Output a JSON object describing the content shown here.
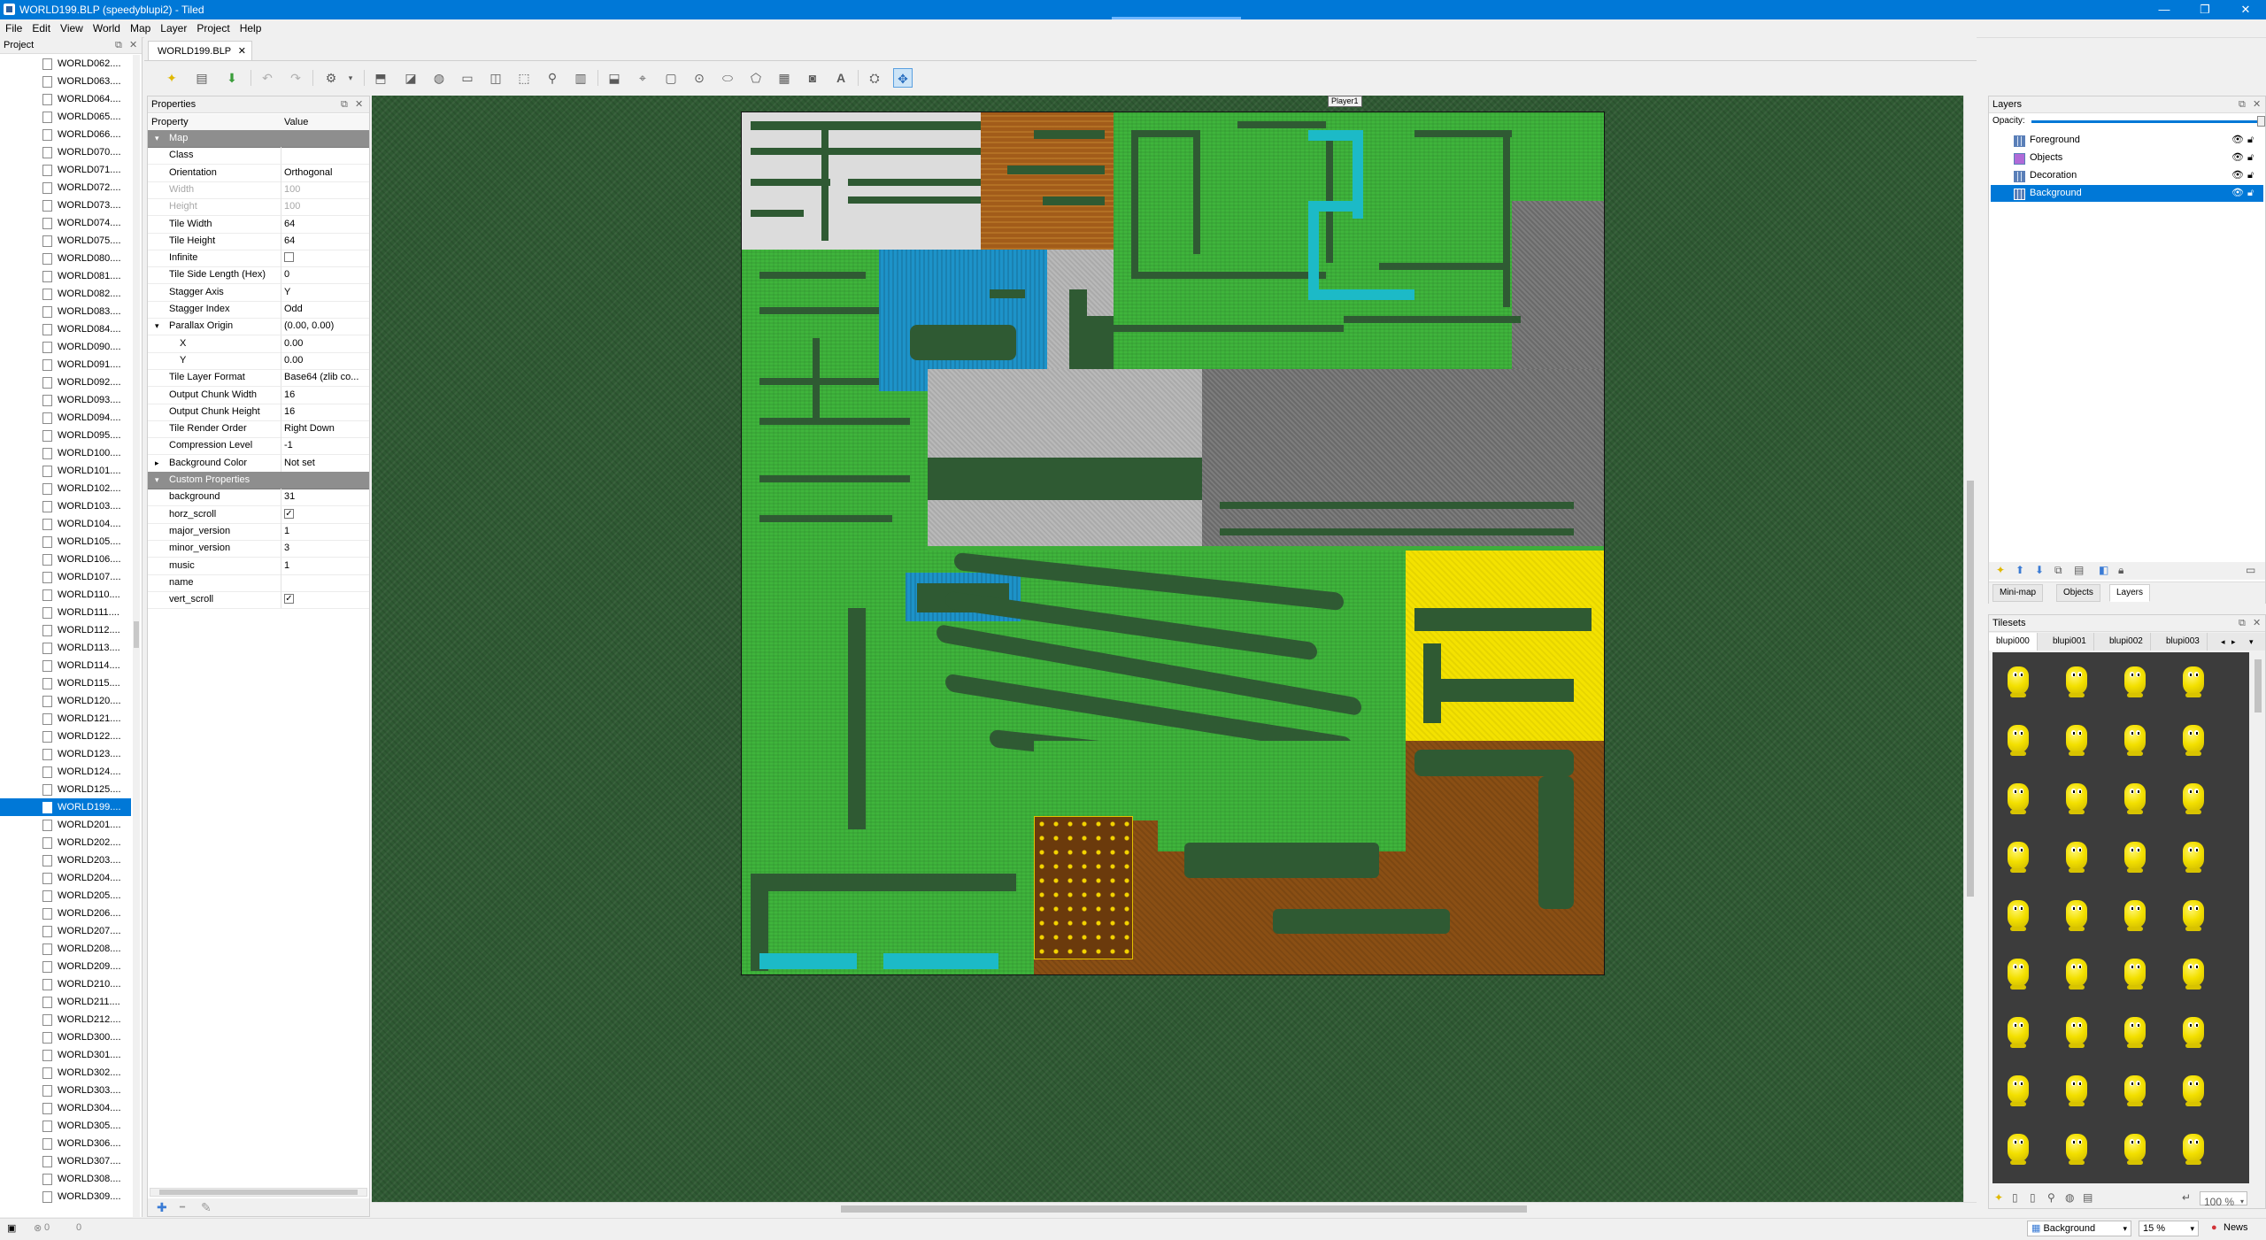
{
  "window": {
    "title": "WORLD199.BLP (speedyblupi2) - Tiled",
    "minimize": "—",
    "maximize": "❐",
    "close": "✕"
  },
  "menu": [
    "File",
    "Edit",
    "View",
    "World",
    "Map",
    "Layer",
    "Project",
    "Help"
  ],
  "project": {
    "title": "Project",
    "selected": "WORLD199....",
    "items": [
      "WORLD062....",
      "WORLD063....",
      "WORLD064....",
      "WORLD065....",
      "WORLD066....",
      "WORLD070....",
      "WORLD071....",
      "WORLD072....",
      "WORLD073....",
      "WORLD074....",
      "WORLD075....",
      "WORLD080....",
      "WORLD081....",
      "WORLD082....",
      "WORLD083....",
      "WORLD084....",
      "WORLD090....",
      "WORLD091....",
      "WORLD092....",
      "WORLD093....",
      "WORLD094....",
      "WORLD095....",
      "WORLD100....",
      "WORLD101....",
      "WORLD102....",
      "WORLD103....",
      "WORLD104....",
      "WORLD105....",
      "WORLD106....",
      "WORLD107....",
      "WORLD110....",
      "WORLD111....",
      "WORLD112....",
      "WORLD113....",
      "WORLD114....",
      "WORLD115....",
      "WORLD120....",
      "WORLD121....",
      "WORLD122....",
      "WORLD123....",
      "WORLD124....",
      "WORLD125....",
      "WORLD199....",
      "WORLD201....",
      "WORLD202....",
      "WORLD203....",
      "WORLD204....",
      "WORLD205....",
      "WORLD206....",
      "WORLD207....",
      "WORLD208....",
      "WORLD209....",
      "WORLD210....",
      "WORLD211....",
      "WORLD212....",
      "WORLD300....",
      "WORLD301....",
      "WORLD302....",
      "WORLD303....",
      "WORLD304....",
      "WORLD305....",
      "WORLD306....",
      "WORLD307....",
      "WORLD308....",
      "WORLD309...."
    ]
  },
  "doc_tab": {
    "label": "WORLD199.BLP",
    "close": "✕"
  },
  "properties": {
    "title": "Properties",
    "col_property": "Property",
    "col_value": "Value",
    "rows": [
      {
        "key": "Map",
        "value": "",
        "type": "group",
        "arrow": "▾"
      },
      {
        "key": "Class",
        "value": ""
      },
      {
        "key": "Orientation",
        "value": "Orthogonal"
      },
      {
        "key": "Width",
        "value": "100",
        "type": "dis"
      },
      {
        "key": "Height",
        "value": "100",
        "type": "dis"
      },
      {
        "key": "Tile Width",
        "value": "64"
      },
      {
        "key": "Tile Height",
        "value": "64"
      },
      {
        "key": "Infinite",
        "value": "",
        "type": "check",
        "checked": false
      },
      {
        "key": "Tile Side Length (Hex)",
        "value": "0"
      },
      {
        "key": "Stagger Axis",
        "value": "Y"
      },
      {
        "key": "Stagger Index",
        "value": "Odd"
      },
      {
        "key": "Parallax Origin",
        "value": "(0.00, 0.00)",
        "arrow": "▾"
      },
      {
        "key": "X",
        "value": "0.00",
        "indent": true
      },
      {
        "key": "Y",
        "value": "0.00",
        "indent": true
      },
      {
        "key": "Tile Layer Format",
        "value": "Base64 (zlib co..."
      },
      {
        "key": "Output Chunk Width",
        "value": "16"
      },
      {
        "key": "Output Chunk Height",
        "value": "16"
      },
      {
        "key": "Tile Render Order",
        "value": "Right Down"
      },
      {
        "key": "Compression Level",
        "value": "-1"
      },
      {
        "key": "Background Color",
        "value": "Not set",
        "arrow": "▸"
      },
      {
        "key": "Custom Properties",
        "value": "",
        "type": "group",
        "arrow": "▾"
      },
      {
        "key": "background",
        "value": "31"
      },
      {
        "key": "horz_scroll",
        "value": "",
        "type": "check",
        "checked": true
      },
      {
        "key": "major_version",
        "value": "1"
      },
      {
        "key": "minor_version",
        "value": "3"
      },
      {
        "key": "music",
        "value": "1"
      },
      {
        "key": "name",
        "value": ""
      },
      {
        "key": "vert_scroll",
        "value": "",
        "type": "check",
        "checked": true
      }
    ],
    "add": "✚",
    "remove": "━",
    "edit": "✎"
  },
  "map": {
    "player_label": "Player1",
    "background_color": "#2f5a33"
  },
  "layers": {
    "title": "Layers",
    "opacity_label": "Opacity:",
    "opacity": 1.0,
    "items": [
      {
        "name": "Foreground",
        "kind": "tile",
        "selected": false
      },
      {
        "name": "Objects",
        "kind": "object",
        "selected": false
      },
      {
        "name": "Decoration",
        "kind": "tile",
        "selected": false
      },
      {
        "name": "Background",
        "kind": "tile",
        "selected": true
      }
    ],
    "tabs": [
      "Mini-map",
      "Objects",
      "Layers"
    ],
    "active_tab": "Layers"
  },
  "tilesets": {
    "title": "Tilesets",
    "tabs": [
      "blupi000",
      "blupi001",
      "blupi002",
      "blupi003"
    ],
    "active_tab": "blupi000",
    "zoom": "100 %"
  },
  "status": {
    "errors": "0",
    "warnings": "0",
    "layer_combo": "Background",
    "zoom_combo": "15 %",
    "news": "News"
  }
}
